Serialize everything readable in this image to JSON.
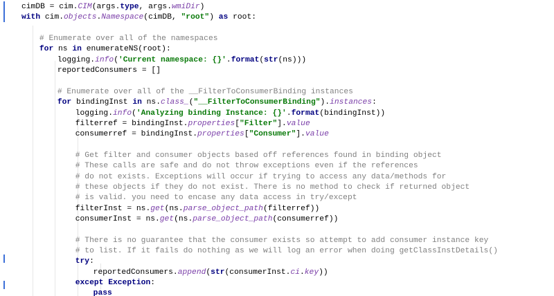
{
  "editor": {
    "language": "python",
    "lines": [
      {
        "indent": 4,
        "segments": [
          {
            "t": "cimDB = cim.",
            "c": ""
          },
          {
            "t": "CIM",
            "c": "it"
          },
          {
            "t": "(args.",
            "c": ""
          },
          {
            "t": "type",
            "c": "kw"
          },
          {
            "t": ", args.",
            "c": ""
          },
          {
            "t": "wmiDir",
            "c": "it"
          },
          {
            "t": ")",
            "c": ""
          }
        ]
      },
      {
        "indent": 4,
        "segments": [
          {
            "t": "with ",
            "c": "kw"
          },
          {
            "t": "cim.",
            "c": ""
          },
          {
            "t": "objects",
            "c": "it"
          },
          {
            "t": ".",
            "c": ""
          },
          {
            "t": "Namespace",
            "c": "it"
          },
          {
            "t": "(cimDB, ",
            "c": ""
          },
          {
            "t": "\"root\"",
            "c": "st"
          },
          {
            "t": ") ",
            "c": ""
          },
          {
            "t": "as ",
            "c": "kw"
          },
          {
            "t": "root:",
            "c": ""
          }
        ]
      },
      {
        "indent": 0,
        "segments": []
      },
      {
        "indent": 8,
        "segments": [
          {
            "t": "# Enumerate over all of the namespaces",
            "c": "cm"
          }
        ]
      },
      {
        "indent": 8,
        "segments": [
          {
            "t": "for ",
            "c": "kw"
          },
          {
            "t": "ns ",
            "c": ""
          },
          {
            "t": "in ",
            "c": "kw"
          },
          {
            "t": "enumerateNS(root):",
            "c": ""
          }
        ]
      },
      {
        "indent": 12,
        "segments": [
          {
            "t": "logging.",
            "c": ""
          },
          {
            "t": "info",
            "c": "it"
          },
          {
            "t": "(",
            "c": ""
          },
          {
            "t": "'Current namespace: {}'",
            "c": "st"
          },
          {
            "t": ".",
            "c": ""
          },
          {
            "t": "format",
            "c": "kw"
          },
          {
            "t": "(",
            "c": ""
          },
          {
            "t": "str",
            "c": "kw"
          },
          {
            "t": "(ns)))",
            "c": ""
          }
        ]
      },
      {
        "indent": 12,
        "segments": [
          {
            "t": "reportedConsumers = []",
            "c": ""
          }
        ]
      },
      {
        "indent": 0,
        "segments": []
      },
      {
        "indent": 12,
        "segments": [
          {
            "t": "# Enumerate over all of the __FilterToConsumerBinding instances",
            "c": "cm"
          }
        ]
      },
      {
        "indent": 12,
        "segments": [
          {
            "t": "for ",
            "c": "kw"
          },
          {
            "t": "bindingInst ",
            "c": ""
          },
          {
            "t": "in ",
            "c": "kw"
          },
          {
            "t": "ns.",
            "c": ""
          },
          {
            "t": "class_",
            "c": "it"
          },
          {
            "t": "(",
            "c": ""
          },
          {
            "t": "\"__FilterToConsumerBinding\"",
            "c": "st"
          },
          {
            "t": ").",
            "c": ""
          },
          {
            "t": "instances",
            "c": "it"
          },
          {
            "t": ":",
            "c": ""
          }
        ]
      },
      {
        "indent": 16,
        "segments": [
          {
            "t": "logging.",
            "c": ""
          },
          {
            "t": "info",
            "c": "it"
          },
          {
            "t": "(",
            "c": ""
          },
          {
            "t": "'Analyzing binding Instance: {}'",
            "c": "st"
          },
          {
            "t": ".",
            "c": ""
          },
          {
            "t": "format",
            "c": "kw"
          },
          {
            "t": "(bindingInst))",
            "c": ""
          }
        ]
      },
      {
        "indent": 16,
        "segments": [
          {
            "t": "filterref = bindingInst.",
            "c": ""
          },
          {
            "t": "properties",
            "c": "it"
          },
          {
            "t": "[",
            "c": ""
          },
          {
            "t": "\"Filter\"",
            "c": "st"
          },
          {
            "t": "].",
            "c": ""
          },
          {
            "t": "value",
            "c": "it"
          }
        ]
      },
      {
        "indent": 16,
        "segments": [
          {
            "t": "consumerref = bindingInst.",
            "c": ""
          },
          {
            "t": "properties",
            "c": "it"
          },
          {
            "t": "[",
            "c": ""
          },
          {
            "t": "\"Consumer\"",
            "c": "st"
          },
          {
            "t": "].",
            "c": ""
          },
          {
            "t": "value",
            "c": "it"
          }
        ]
      },
      {
        "indent": 0,
        "segments": []
      },
      {
        "indent": 16,
        "segments": [
          {
            "t": "# Get filter and consumer objects based off references found in binding object",
            "c": "cm"
          }
        ]
      },
      {
        "indent": 16,
        "segments": [
          {
            "t": "# These calls are safe and do not throw exceptions even if the references",
            "c": "cm"
          }
        ]
      },
      {
        "indent": 16,
        "segments": [
          {
            "t": "# do not exists. Exceptions will occur if trying to access any data/methods for",
            "c": "cm"
          }
        ]
      },
      {
        "indent": 16,
        "segments": [
          {
            "t": "# these objects if they do not exist. There is no method to check if returned object",
            "c": "cm"
          }
        ]
      },
      {
        "indent": 16,
        "segments": [
          {
            "t": "# is valid. you need to encase any data access in try/except",
            "c": "cm"
          }
        ]
      },
      {
        "indent": 16,
        "segments": [
          {
            "t": "filterInst = ns.",
            "c": ""
          },
          {
            "t": "get",
            "c": "it"
          },
          {
            "t": "(ns.",
            "c": ""
          },
          {
            "t": "parse_object_path",
            "c": "it"
          },
          {
            "t": "(filterref))",
            "c": ""
          }
        ]
      },
      {
        "indent": 16,
        "segments": [
          {
            "t": "consumerInst = ns.",
            "c": ""
          },
          {
            "t": "get",
            "c": "it"
          },
          {
            "t": "(ns.",
            "c": ""
          },
          {
            "t": "parse_object_path",
            "c": "it"
          },
          {
            "t": "(consumerref))",
            "c": ""
          }
        ]
      },
      {
        "indent": 0,
        "segments": []
      },
      {
        "indent": 16,
        "segments": [
          {
            "t": "# There is no guarantee that the consumer exists so attempt to add consumer instance key",
            "c": "cm"
          }
        ]
      },
      {
        "indent": 16,
        "segments": [
          {
            "t": "# to list. If it fails do nothing as we will log an error when doing getClassInstDetails()",
            "c": "cm"
          }
        ]
      },
      {
        "indent": 16,
        "segments": [
          {
            "t": "try",
            "c": "kw"
          },
          {
            "t": ":",
            "c": ""
          }
        ]
      },
      {
        "indent": 20,
        "segments": [
          {
            "t": "reportedConsumers.",
            "c": ""
          },
          {
            "t": "append",
            "c": "it"
          },
          {
            "t": "(",
            "c": ""
          },
          {
            "t": "str",
            "c": "kw"
          },
          {
            "t": "(consumerInst.",
            "c": ""
          },
          {
            "t": "ci",
            "c": "it"
          },
          {
            "t": ".",
            "c": ""
          },
          {
            "t": "key",
            "c": "it"
          },
          {
            "t": "))",
            "c": ""
          }
        ]
      },
      {
        "indent": 16,
        "segments": [
          {
            "t": "except ",
            "c": "kw"
          },
          {
            "t": "Exception",
            "c": "kw"
          },
          {
            "t": ":",
            "c": ""
          }
        ]
      },
      {
        "indent": 20,
        "segments": [
          {
            "t": "pass",
            "c": "kw"
          }
        ]
      }
    ]
  }
}
